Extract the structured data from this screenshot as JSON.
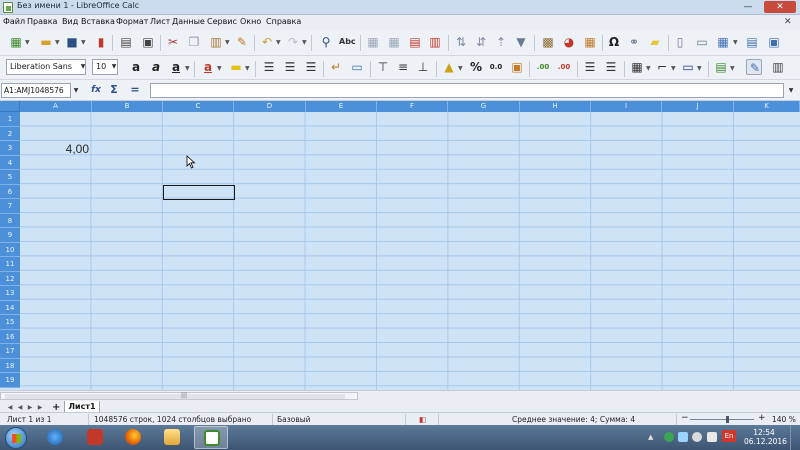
{
  "window": {
    "title": "Без имени 1 - LibreOffice Calc",
    "minimize": "—",
    "maximize": "□",
    "close": "✕"
  },
  "menu": {
    "items": [
      "Файл",
      "Правка",
      "Вид",
      "Вставка",
      "Формат",
      "Лист",
      "Данные",
      "Сервис",
      "Окно",
      "Справка"
    ],
    "doc_close": "✕"
  },
  "toolbar": {
    "font_name": "Liberation Sans",
    "font_size": "10",
    "spellcheck_label": "Abc",
    "percent": "%",
    "number_format": "0.0",
    "decimals_add": ".00",
    "decimals_remove": ".00"
  },
  "formula_bar": {
    "name_box": "A1:AMJ1048576",
    "fx": "fx",
    "sum": "Σ",
    "equals": "=",
    "input": ""
  },
  "grid": {
    "columns": [
      "A",
      "B",
      "C",
      "D",
      "E",
      "F",
      "G",
      "H",
      "I",
      "J",
      "K"
    ],
    "rows": [
      "1",
      "2",
      "3",
      "4",
      "5",
      "6",
      "7",
      "8",
      "9",
      "10",
      "11",
      "12",
      "13",
      "14",
      "15",
      "16",
      "17",
      "18",
      "19"
    ],
    "cells": {
      "A3": "4,00"
    },
    "selection_color": "#cfe3f7",
    "header_color": "#4b90d9"
  },
  "sheets": {
    "tabs": [
      "Лист1"
    ],
    "add": "+",
    "nav": [
      "◀",
      "◀",
      "▶",
      "▶"
    ],
    "grip": "|||"
  },
  "status": {
    "sheet": "Лист 1 из 1",
    "selection": "1048576 строк, 1024 столбцов выбрано",
    "style": "Базовый",
    "summary": "Среднее значение: 4; Сумма: 4",
    "zoom_minus": "−",
    "zoom_plus": "+",
    "zoom": "140 %"
  },
  "taskbar": {
    "lang": "En",
    "time": "12:54",
    "date": "06.12.2016"
  }
}
